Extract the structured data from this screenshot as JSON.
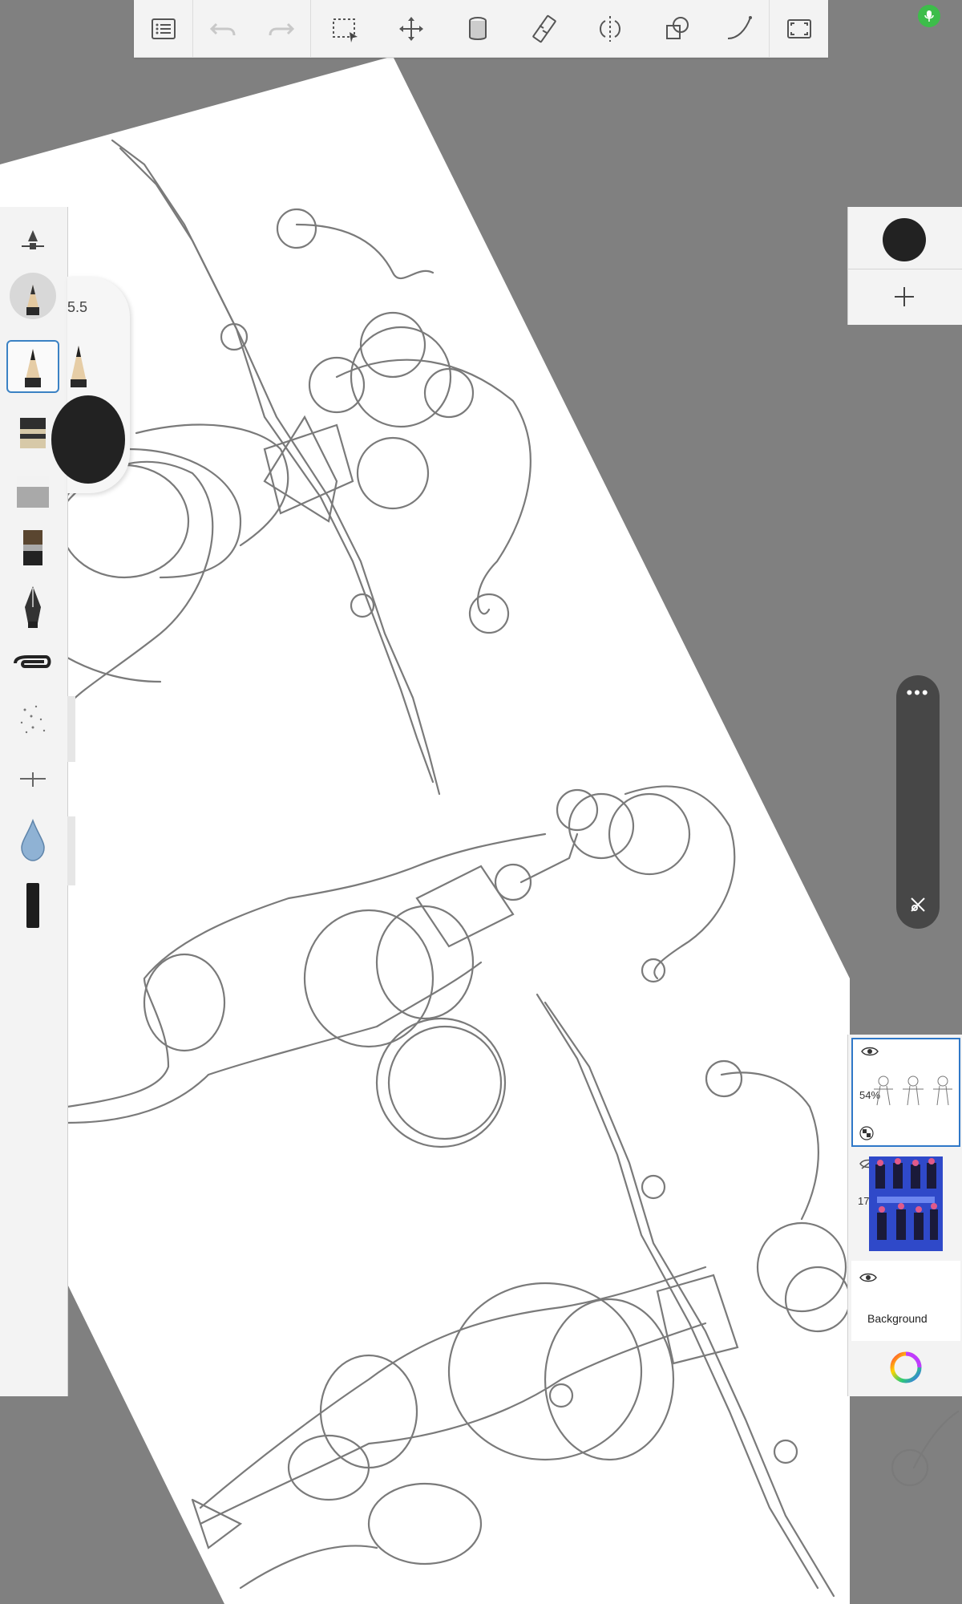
{
  "app": {
    "top_toolbar": {
      "items": [
        {
          "name": "layers-list-icon"
        },
        {
          "name": "undo-icon"
        },
        {
          "name": "redo-icon"
        },
        {
          "name": "selection-icon"
        },
        {
          "name": "move-transform-icon"
        },
        {
          "name": "fill-bucket-icon"
        },
        {
          "name": "ruler-icon"
        },
        {
          "name": "symmetry-icon"
        },
        {
          "name": "shapes-icon"
        },
        {
          "name": "stroke-stylize-icon"
        },
        {
          "name": "fullscreen-icon"
        }
      ]
    },
    "brush_panel": {
      "size_value": "5.5",
      "brushes": [
        {
          "name": "brush-size-slider-icon"
        },
        {
          "name": "pencil-brush-icon"
        },
        {
          "name": "pencil-brush-selected-icon"
        },
        {
          "name": "marker-brush-icon"
        },
        {
          "name": "eraser-brush-icon"
        },
        {
          "name": "paint-brush-icon"
        },
        {
          "name": "ink-pen-icon"
        },
        {
          "name": "clip-tool-icon"
        },
        {
          "name": "spray-brush-icon"
        },
        {
          "name": "cross-brush-icon"
        },
        {
          "name": "blender-drop-icon"
        },
        {
          "name": "dark-stroke-brush-icon"
        }
      ],
      "selected_index": 2
    },
    "layers_panel": {
      "current_color": "#222222",
      "layers": [
        {
          "opacity": "54%",
          "visible": true,
          "thumbnail": "sketch-thumbnail",
          "selected": true
        },
        {
          "opacity": "17%",
          "visible": false,
          "thumbnail": "blue-reference-thumbnail",
          "selected": false
        },
        {
          "name": "Background",
          "visible": true,
          "selected": false
        }
      ]
    },
    "colors": {
      "accent": "#2f78c8",
      "toolbar_bg": "#f3f3f3",
      "canvas_bg": "#808080",
      "mic_green": "#3dbd4a"
    }
  }
}
